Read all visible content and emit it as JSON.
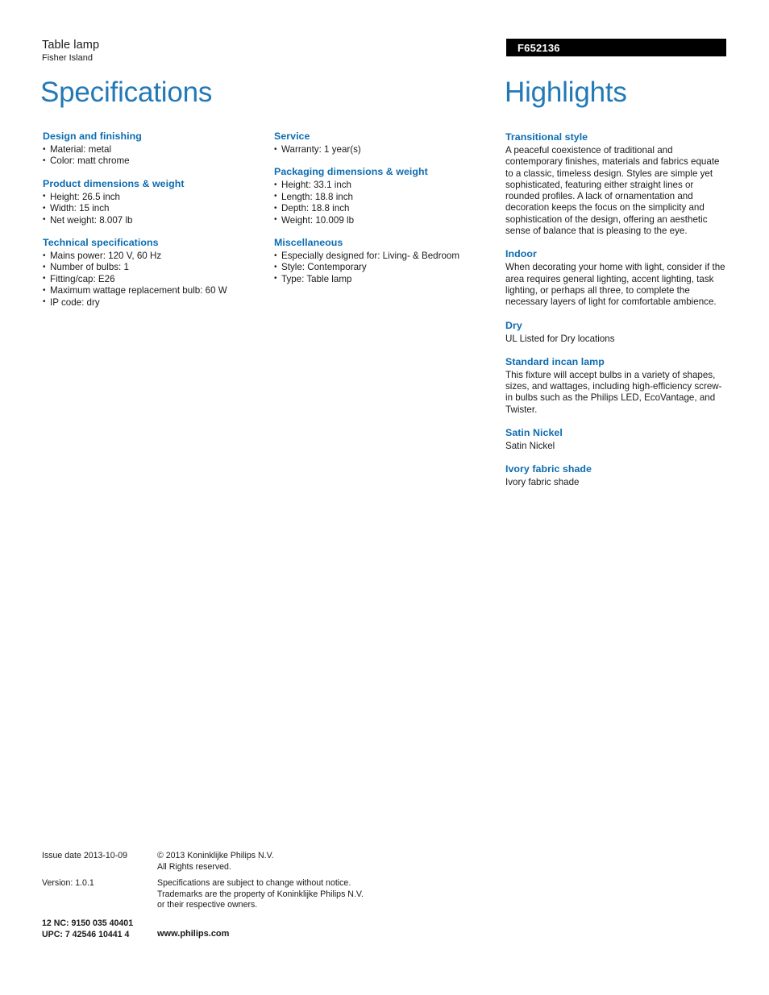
{
  "header": {
    "product_type": "Table lamp",
    "product_name": "Fisher Island",
    "model_code": "F652136"
  },
  "titles": {
    "specifications": "Specifications",
    "highlights": "Highlights"
  },
  "specifications": {
    "column_1": [
      {
        "heading": "Design and finishing",
        "items": [
          "Material: metal",
          "Color: matt chrome"
        ]
      },
      {
        "heading": "Product dimensions & weight",
        "items": [
          "Height: 26.5 inch",
          "Width: 15 inch",
          "Net weight: 8.007 lb"
        ]
      },
      {
        "heading": "Technical specifications",
        "items": [
          "Mains power: 120 V, 60 Hz",
          "Number of bulbs: 1",
          "Fitting/cap: E26",
          "Maximum wattage replacement bulb: 60 W",
          "IP code: dry"
        ]
      }
    ],
    "column_2": [
      {
        "heading": "Service",
        "items": [
          "Warranty: 1 year(s)"
        ]
      },
      {
        "heading": "Packaging dimensions & weight",
        "items": [
          "Height: 33.1 inch",
          "Length: 18.8 inch",
          "Depth: 18.8 inch",
          "Weight: 10.009 lb"
        ]
      },
      {
        "heading": "Miscellaneous",
        "items": [
          "Especially designed for: Living- & Bedroom",
          "Style: Contemporary",
          "Type: Table lamp"
        ]
      }
    ]
  },
  "highlights": [
    {
      "heading": "Transitional style",
      "body": "A peaceful coexistence of traditional and contemporary finishes, materials and fabrics equate to a classic, timeless design. Styles are simple yet sophisticated, featuring either straight lines or rounded profiles. A lack of ornamentation and decoration keeps the focus on the simplicity and sophistication of the design, offering an aesthetic sense of balance that is pleasing to the eye."
    },
    {
      "heading": "Indoor",
      "body": "When decorating your home with light, consider if the area requires general lighting, accent lighting, task lighting, or perhaps all three, to complete the necessary layers of light for comfortable ambience."
    },
    {
      "heading": "Dry",
      "body": "UL Listed for Dry locations"
    },
    {
      "heading": "Standard incan lamp",
      "body": "This fixture will accept bulbs in a variety of shapes, sizes, and wattages, including high-efficiency screw-in bulbs such as the Philips LED, EcoVantage, and Twister."
    },
    {
      "heading": "Satin Nickel",
      "body": "Satin Nickel"
    },
    {
      "heading": "Ivory fabric shade",
      "body": "Ivory fabric shade"
    }
  ],
  "footer": {
    "issue_date": "Issue date 2013-10-09",
    "copyright_line_1": "© 2013 Koninklijke Philips N.V.",
    "copyright_line_2": "All Rights reserved.",
    "version": "Version: 1.0.1",
    "disclaimer_line_1": "Specifications are subject to change without notice.",
    "disclaimer_line_2": "Trademarks are the property of Koninklijke Philips N.V.",
    "disclaimer_line_3": "or their respective owners.",
    "nc_code": "12 NC: 9150 035 40401",
    "upc_code": "UPC: 7 42546 10441 4",
    "website": "www.philips.com"
  },
  "colors": {
    "title_blue": "#2279b6",
    "heading_blue": "#0d6cb0",
    "code_bar_bg": "#000000",
    "body_text": "#1a1a1a"
  }
}
